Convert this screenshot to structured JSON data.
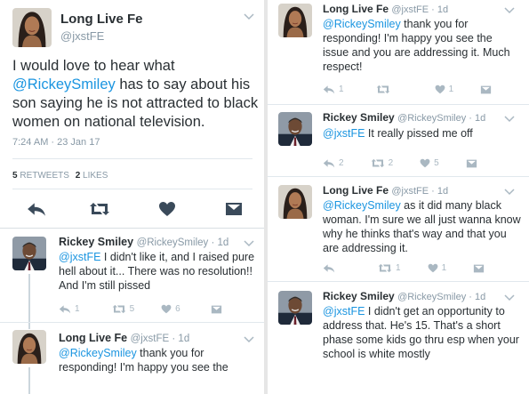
{
  "colors": {
    "accent": "#1b95e0",
    "muted": "#8899a6",
    "icon": "#aab8c2",
    "text": "#292f33"
  },
  "main_tweet": {
    "name": "Long Live Fe",
    "handle": "@jxstFE",
    "text_1": "I would love to hear what ",
    "mention": "@RickeySmiley",
    "text_2": " has to say about his son saying he is not attracted to black women on national television.",
    "timestamp": "7:24 AM · 23 Jan 17",
    "retweets_count": "5",
    "retweets_label": "RETWEETS",
    "likes_count": "2",
    "likes_label": "LIKES",
    "icons": [
      "reply-icon",
      "retweet-icon",
      "like-icon",
      "direct-message-icon"
    ]
  },
  "replies_left": [
    {
      "name": "Rickey Smiley",
      "handle": "@RickeySmiley · 1d",
      "mention": "@jxstFE",
      "text": " I didn't like it, and I raised pure hell about it... There was no resolution!! And I'm still pissed",
      "reply_count": "1",
      "retweet_count": "5",
      "like_count": "6"
    },
    {
      "name": "Long Live Fe",
      "handle": "@jxstFE · 1d",
      "mention": "@RickeySmiley",
      "text": " thank you for responding! I'm happy you see the"
    }
  ],
  "replies_right": [
    {
      "name": "Long Live Fe",
      "handle": "@jxstFE · 1d",
      "mention": "@RickeySmiley",
      "text": " thank you for responding! I'm happy you see the issue and you are addressing it. Much respect!",
      "reply_count": "1",
      "retweet_count": "",
      "like_count": "1"
    },
    {
      "name": "Rickey Smiley",
      "handle": "@RickeySmiley · 1d",
      "mention": "@jxstFE",
      "text": " It really pissed me off",
      "reply_count": "2",
      "retweet_count": "2",
      "like_count": "5"
    },
    {
      "name": "Long Live Fe",
      "handle": "@jxstFE · 1d",
      "mention": "@RickeySmiley",
      "text": " as it did many black woman. I'm sure we all just wanna know why he thinks that's way and that you are addressing it.",
      "reply_count": "",
      "retweet_count": "1",
      "like_count": "1"
    },
    {
      "name": "Rickey Smiley",
      "handle": "@RickeySmiley · 1d",
      "mention": "@jxstFE",
      "text": " I didn't get an opportunity to address that. He's 15. That's a short phase some kids go thru esp when your school is white mostly"
    }
  ]
}
